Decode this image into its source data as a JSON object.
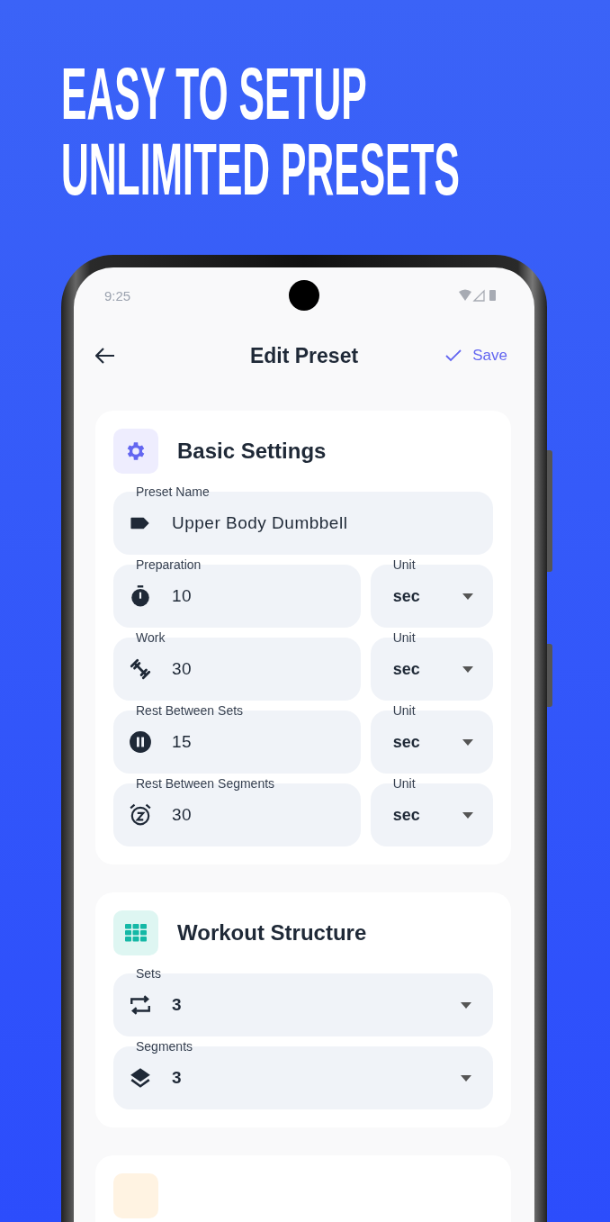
{
  "headline": [
    "EASY TO SETUP",
    "UNLIMITED PRESETS"
  ],
  "status_bar": {
    "time": "9:25"
  },
  "app_bar": {
    "title": "Edit Preset",
    "action": "Save"
  },
  "sections": [
    {
      "title": "Basic Settings",
      "fields": [
        {
          "kind": "text",
          "label": "Preset Name",
          "value": "Upper Body Dumbbell"
        },
        {
          "kind": "duration",
          "label": "Preparation",
          "value": "10",
          "unit_label": "Unit",
          "unit": "sec"
        },
        {
          "kind": "duration",
          "label": "Work",
          "value": "30",
          "unit_label": "Unit",
          "unit": "sec"
        },
        {
          "kind": "duration",
          "label": "Rest Between Sets",
          "value": "15",
          "unit_label": "Unit",
          "unit": "sec"
        },
        {
          "kind": "duration",
          "label": "Rest Between Segments",
          "value": "30",
          "unit_label": "Unit",
          "unit": "sec"
        }
      ]
    },
    {
      "title": "Workout Structure",
      "fields": [
        {
          "kind": "select",
          "label": "Sets",
          "value": "3"
        },
        {
          "kind": "select",
          "label": "Segments",
          "value": "3"
        }
      ]
    }
  ]
}
